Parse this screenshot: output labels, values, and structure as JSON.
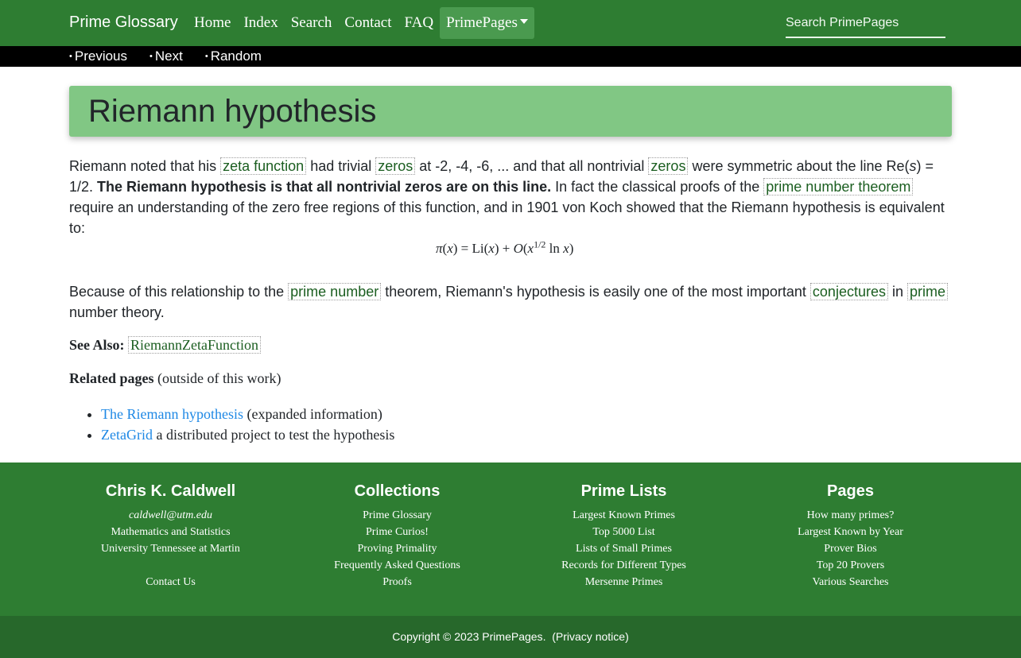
{
  "nav": {
    "brand": "Prime Glossary",
    "links": [
      "Home",
      "Index",
      "Search",
      "Contact",
      "FAQ",
      "PrimePages"
    ],
    "search_placeholder": "Search PrimePages"
  },
  "subnav": [
    "Previous",
    "Next",
    "Random"
  ],
  "title": "Riemann hypothesis",
  "p1": {
    "t1": "Riemann noted that his ",
    "l1": "zeta function",
    "t2": " had trivial ",
    "l2": "zeros",
    "t3": " at -2, -4, -6, ... and that all nontrivial ",
    "l3": "zeros",
    "t4": " were symmetric about the line Re(",
    "s": "s",
    "t5": ") = 1/2. ",
    "bold": "The Riemann hypothesis is that all nontrivial zeros are on this line.",
    "t6": " In fact the classical proofs of the ",
    "l4": "prime number theorem",
    "t7": " require an understanding of the zero free regions of this function, and in 1901 von Koch showed that the Riemann hypothesis is equivalent to:"
  },
  "formula": "π(x) = Li(x) + O(x^{1/2} ln x)",
  "p2": {
    "t1": "Because of this relationship to the ",
    "l1": "prime number",
    "t2": " theorem, Riemann's hypothesis is easily one of the most important ",
    "l2": "conjectures",
    "t3": " in ",
    "l3": "prime",
    "t4": " number theory."
  },
  "see_also": {
    "label": "See Also:",
    "link": "RiemannZetaFunction"
  },
  "related": {
    "label": "Related pages",
    "note": " (outside of this work)",
    "items": [
      {
        "link": "The Riemann hypothesis",
        "text": " (expanded information)"
      },
      {
        "link": "ZetaGrid",
        "text": " a distributed project to test the hypothesis"
      }
    ]
  },
  "footer": {
    "columns": [
      {
        "title": "Chris K. Caldwell",
        "items": [
          "caldwell@utm.edu",
          "Mathematics and Statistics",
          "University Tennessee at Martin",
          "",
          "Contact Us"
        ]
      },
      {
        "title": "Collections",
        "items": [
          "Prime Glossary",
          "Prime Curios!",
          "Proving Primality",
          "Frequently Asked Questions",
          "Proofs"
        ]
      },
      {
        "title": "Prime Lists",
        "items": [
          "Largest Known Primes",
          "Top 5000 List",
          "Lists of Small Primes",
          "Records for Different Types",
          "Mersenne Primes"
        ]
      },
      {
        "title": "Pages",
        "items": [
          "How many primes?",
          "Largest Known by Year",
          "Prover Bios",
          "Top 20 Provers",
          "Various Searches"
        ]
      }
    ]
  },
  "copyright": {
    "text": "Copyright © 2023 ",
    "site": "PrimePages",
    "privacy": "Privacy notice"
  }
}
